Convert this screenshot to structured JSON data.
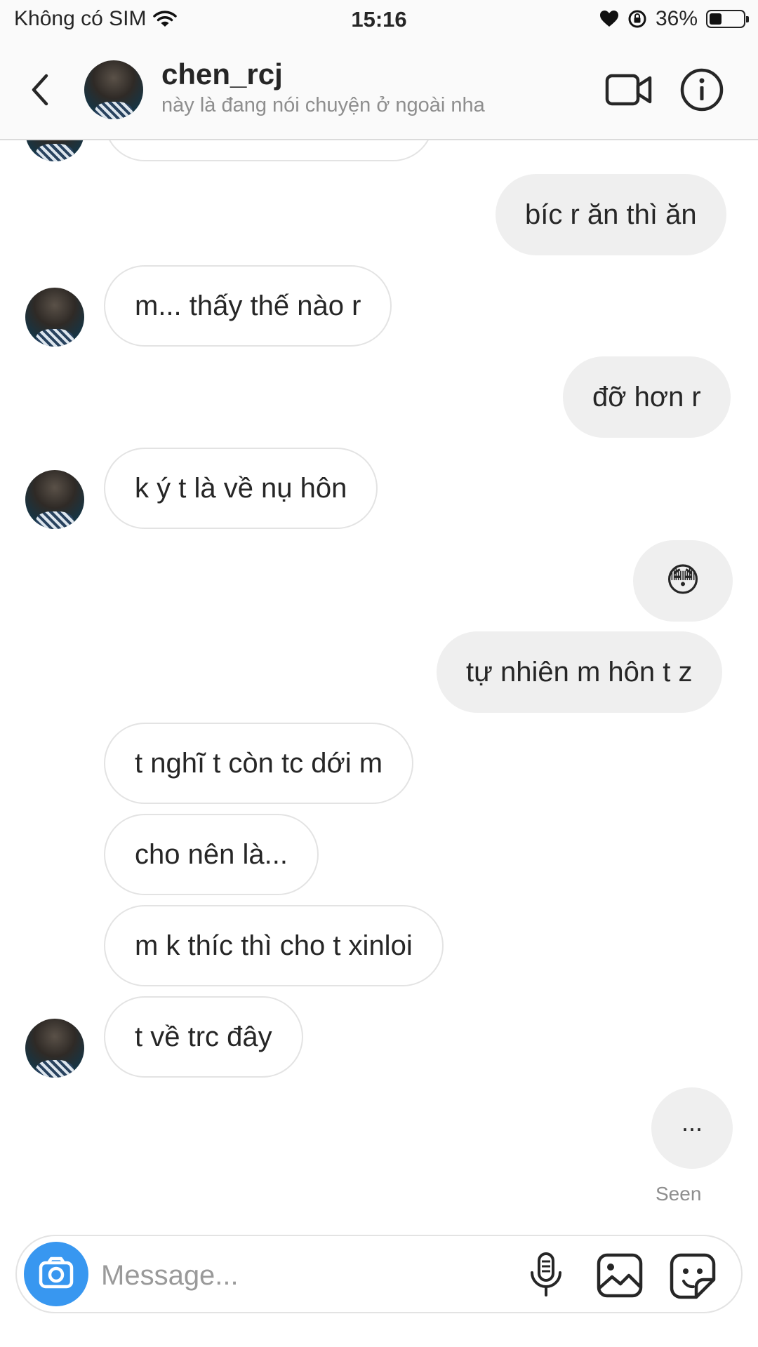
{
  "status_bar": {
    "carrier": "Không có SIM",
    "time": "15:16",
    "battery": "36%",
    "battery_level": 0.36
  },
  "header": {
    "username": "chen_rcj",
    "subtitle": "này là đang nói chuyện ở ngoài nha"
  },
  "messages": [
    {
      "side": "out",
      "text": "bíc r ăn thì ăn"
    },
    {
      "side": "in",
      "text": "m... thấy thế nào r",
      "avatar": true
    },
    {
      "side": "out",
      "text": "đỡ hơn r"
    },
    {
      "side": "in",
      "text": "k ý t là về nụ hôn",
      "avatar": true
    },
    {
      "side": "out",
      "text": "😳"
    },
    {
      "side": "out",
      "text": "tự nhiên m hôn t z"
    },
    {
      "side": "in",
      "text": "t nghĩ t còn tc dới m"
    },
    {
      "side": "in",
      "text": "cho nên là..."
    },
    {
      "side": "in",
      "text": "m k thíc thì cho t xinloi"
    },
    {
      "side": "in",
      "text": "t về trc đây",
      "avatar": true
    },
    {
      "side": "out",
      "text": "..."
    }
  ],
  "seen_label": "Seen",
  "composer": {
    "placeholder": "Message..."
  },
  "colors": {
    "accent": "#3897f0",
    "outgoing_bubble": "#efefef",
    "incoming_border": "#e3e3e3",
    "muted_text": "#8e8e8e"
  }
}
